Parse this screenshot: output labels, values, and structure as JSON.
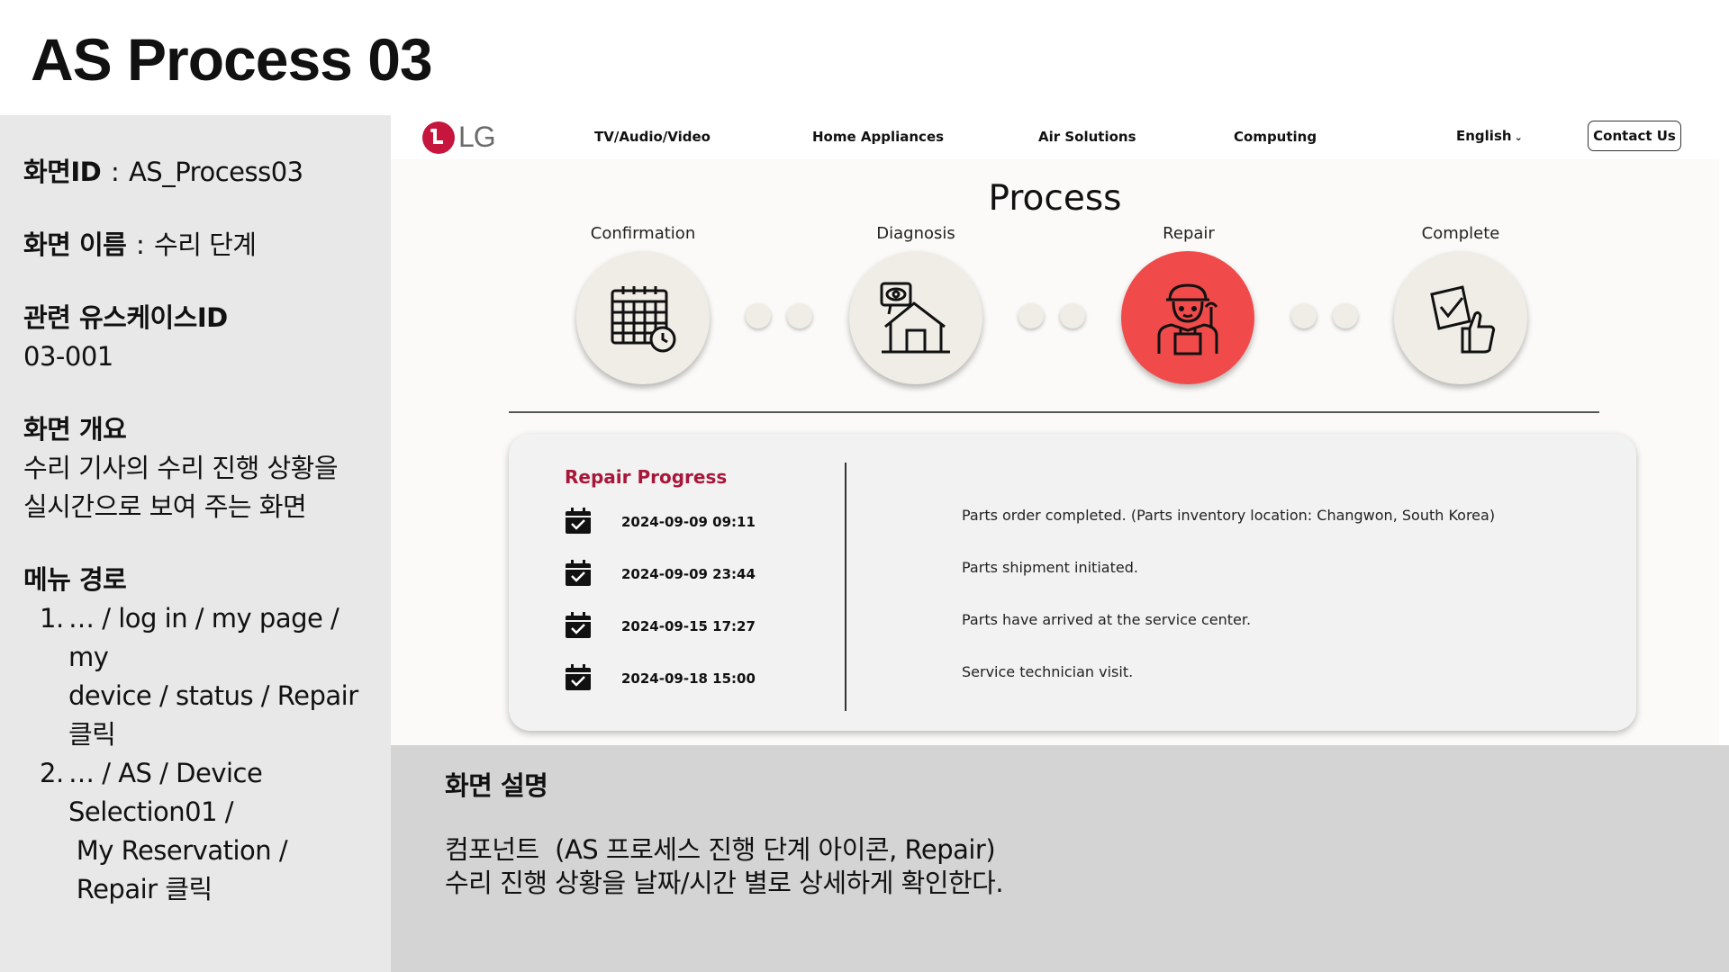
{
  "slide": {
    "title": "AS Process 03"
  },
  "spec": {
    "screen_id_label": "화면ID",
    "screen_id_value": "AS_Process03",
    "screen_name_label": "화면 이름",
    "screen_name_value": "수리 단계",
    "usecase_label": "관련 유스케이스ID",
    "usecase_value": "03-001",
    "overview_label": "화면 개요",
    "overview_line1": "수리 기사의 수리 진행 상황을",
    "overview_line2": "실시간으로 보여 주는 화면",
    "menu_label": "메뉴 경로",
    "menu_items": [
      {
        "num": "1.",
        "lines": [
          "… / log in / my page / my",
          "device / status / Repair",
          "클릭"
        ]
      },
      {
        "num": "2.",
        "lines": [
          "… / AS / Device",
          "Selection01 /",
          " My Reservation /",
          " Repair 클릭"
        ]
      }
    ]
  },
  "site": {
    "logo_text": "LG",
    "nav": [
      "TV/Audio/Video",
      "Home Appliances",
      "Air Solutions",
      "Computing"
    ],
    "language": "English",
    "contact_label": "Contact Us",
    "process_title": "Process",
    "steps": [
      {
        "label": "Confirmation",
        "icon": "calendar-clock-icon",
        "active": false
      },
      {
        "label": "Diagnosis",
        "icon": "house-inspection-icon",
        "active": false
      },
      {
        "label": "Repair",
        "icon": "technician-icon",
        "active": true
      },
      {
        "label": "Complete",
        "icon": "document-thumbs-up-icon",
        "active": false
      }
    ],
    "progress": {
      "title": "Repair Progress",
      "rows": [
        {
          "datetime": "2024-09-09 09:11",
          "description": "Parts order completed. (Parts inventory location: Changwon, South Korea)"
        },
        {
          "datetime": "2024-09-09 23:44",
          "description": "Parts shipment initiated."
        },
        {
          "datetime": "2024-09-15 17:27",
          "description": "Parts have arrived at the service center."
        },
        {
          "datetime": "2024-09-18 15:00",
          "description": "Service technician visit."
        }
      ]
    }
  },
  "description": {
    "heading": "화면 설명",
    "line1": "컴포넌트  (AS 프로세스 진행 단계 아이콘, Repair)",
    "line2": "수리 진행 상황을 날짜/시간 별로 상세하게 확인한다."
  },
  "colors": {
    "accent_red": "#f04a4a",
    "brand_red": "#c6163e",
    "progress_title": "#a8163a",
    "panel_gray": "#e8e8e8",
    "desc_gray": "#d4d4d4"
  }
}
